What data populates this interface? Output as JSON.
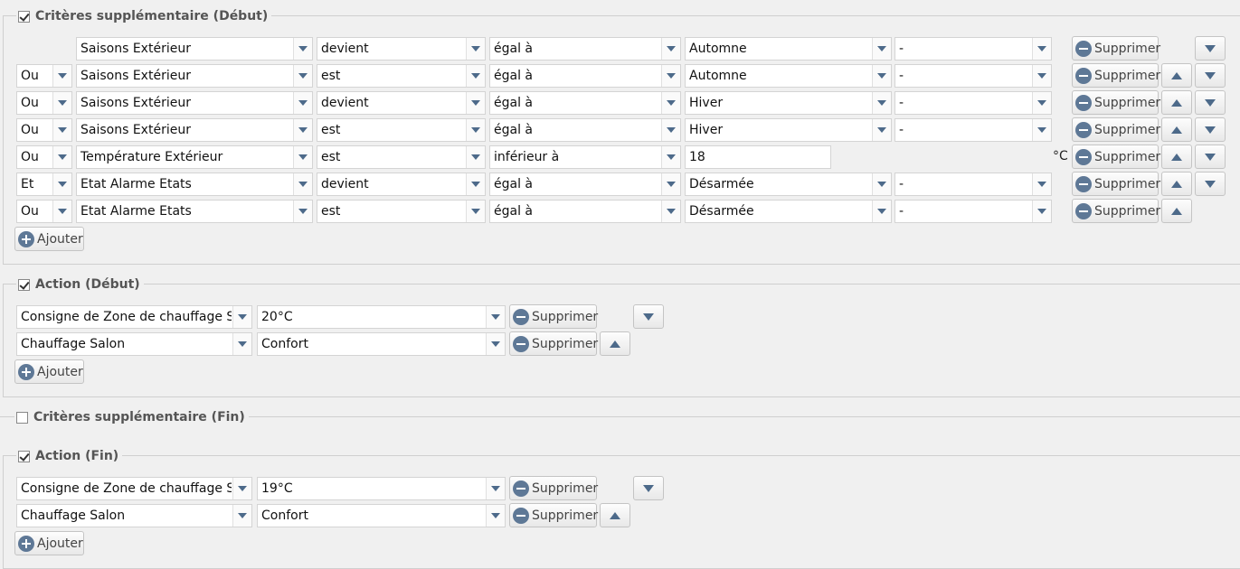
{
  "criteria_start": {
    "legend": "Critères supplémentaire (Début)",
    "checked": true,
    "rows": [
      {
        "connector": "",
        "subject": "Saisons Extérieur",
        "verb": "devient",
        "operator": "égal à",
        "value": "Automne",
        "extra": "-",
        "remove_label": "Supprimer"
      },
      {
        "connector": "Ou",
        "subject": "Saisons Extérieur",
        "verb": "est",
        "operator": "égal à",
        "value": "Automne",
        "extra": "-",
        "remove_label": "Supprimer"
      },
      {
        "connector": "Ou",
        "subject": "Saisons Extérieur",
        "verb": "devient",
        "operator": "égal à",
        "value": "Hiver",
        "extra": "-",
        "remove_label": "Supprimer"
      },
      {
        "connector": "Ou",
        "subject": "Saisons Extérieur",
        "verb": "est",
        "operator": "égal à",
        "value": "Hiver",
        "extra": "-",
        "remove_label": "Supprimer"
      },
      {
        "connector": "Ou",
        "subject": "Température Extérieur",
        "verb": "est",
        "operator": "inférieur à",
        "value": "18",
        "unit": "°C",
        "remove_label": "Supprimer"
      },
      {
        "connector": "Et",
        "subject": "Etat Alarme Etats",
        "verb": "devient",
        "operator": "égal à",
        "value": "Désarmée",
        "extra": "-",
        "remove_label": "Supprimer"
      },
      {
        "connector": "Ou",
        "subject": "Etat Alarme Etats",
        "verb": "est",
        "operator": "égal à",
        "value": "Désarmée",
        "extra": "-",
        "remove_label": "Supprimer"
      }
    ],
    "add_label": "Ajouter"
  },
  "action_start": {
    "legend": "Action (Début)",
    "checked": true,
    "rows": [
      {
        "device": "Consigne de Zone de chauffage Salon",
        "value": "20°C",
        "remove_label": "Supprimer"
      },
      {
        "device": "Chauffage Salon",
        "value": "Confort",
        "remove_label": "Supprimer"
      }
    ],
    "add_label": "Ajouter"
  },
  "criteria_end": {
    "legend": "Critères supplémentaire (Fin)",
    "checked": false
  },
  "action_end": {
    "legend": "Action (Fin)",
    "checked": true,
    "rows": [
      {
        "device": "Consigne de Zone de chauffage Salon",
        "value": "19°C",
        "remove_label": "Supprimer"
      },
      {
        "device": "Chauffage Salon",
        "value": "Confort",
        "remove_label": "Supprimer"
      }
    ],
    "add_label": "Ajouter"
  },
  "icons": {
    "remove": "minus-circle-icon",
    "add": "plus-circle-icon",
    "move_up": "arrow-up-icon",
    "move_down": "arrow-down-icon",
    "dropdown": "chevron-down-icon"
  },
  "colors": {
    "icon_blue": "#5e7896",
    "arrow_blue": "#4d6a8a",
    "background": "#f0f0f0"
  }
}
